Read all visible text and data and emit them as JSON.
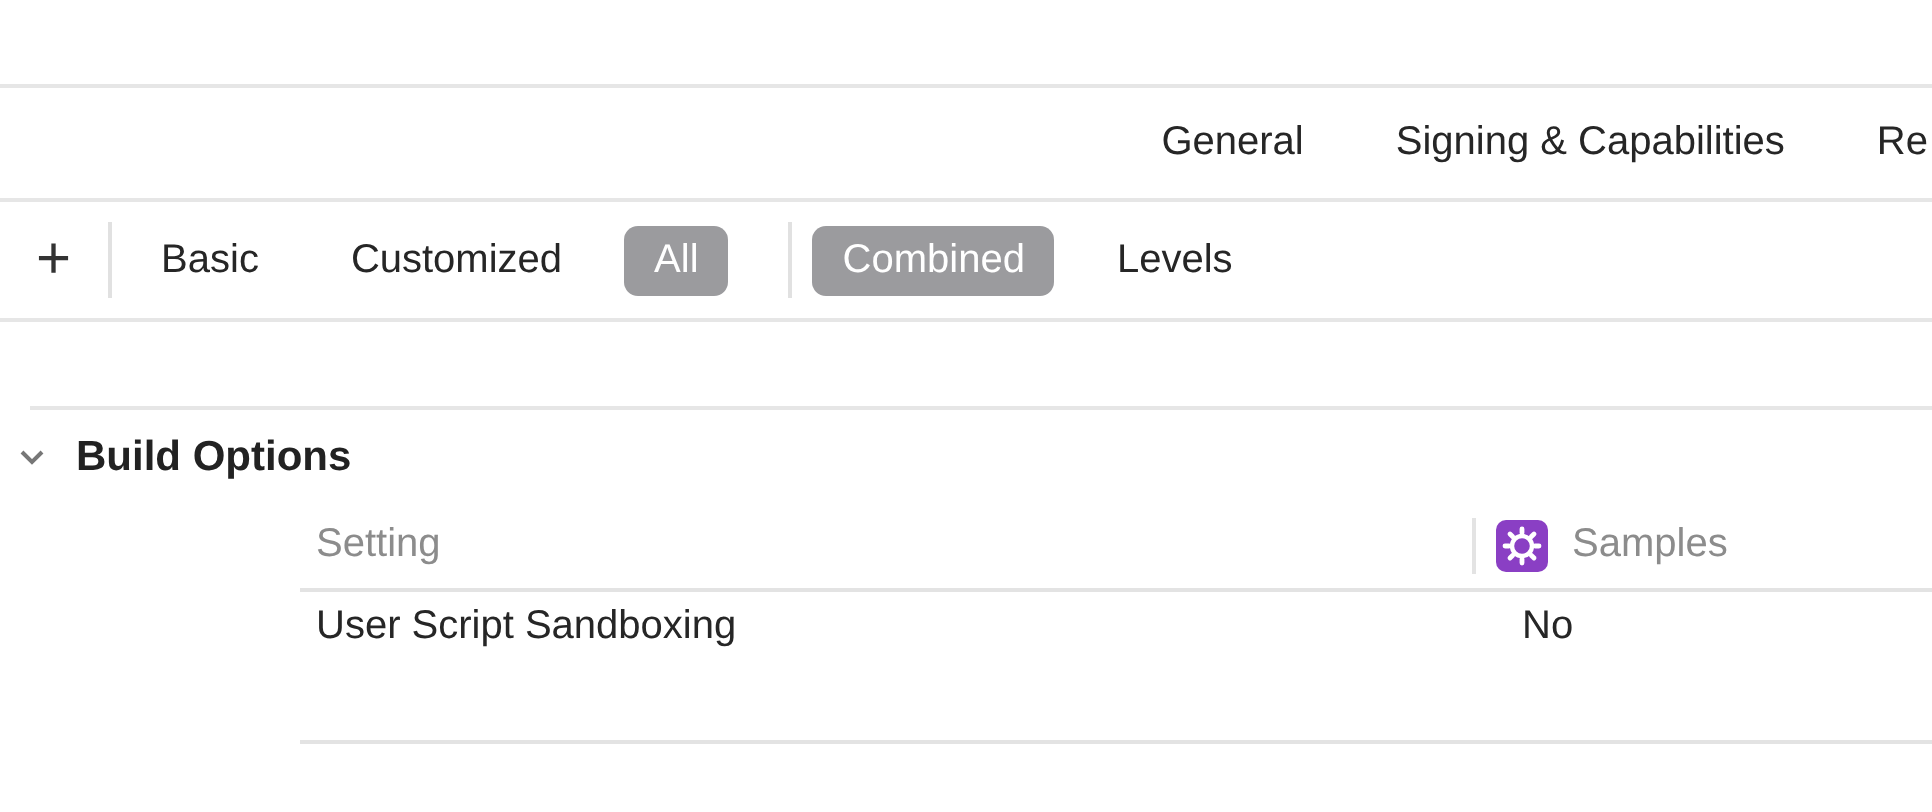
{
  "tabs": [
    {
      "label": "General",
      "selected": false
    },
    {
      "label": "Signing & Capabilities",
      "selected": false
    },
    {
      "label": "Re",
      "selected": false
    }
  ],
  "filter_bar": {
    "add_button": "+",
    "scope": [
      {
        "label": "Basic",
        "selected": false
      },
      {
        "label": "Customized",
        "selected": false
      },
      {
        "label": "All",
        "selected": true
      }
    ],
    "view": [
      {
        "label": "Combined",
        "selected": true
      },
      {
        "label": "Levels",
        "selected": false
      }
    ]
  },
  "section": {
    "title": "Build Options",
    "expanded": true,
    "columns": [
      "Setting",
      "Samples"
    ],
    "rows": [
      {
        "setting": "User Script Sandboxing",
        "value": "No"
      }
    ]
  }
}
